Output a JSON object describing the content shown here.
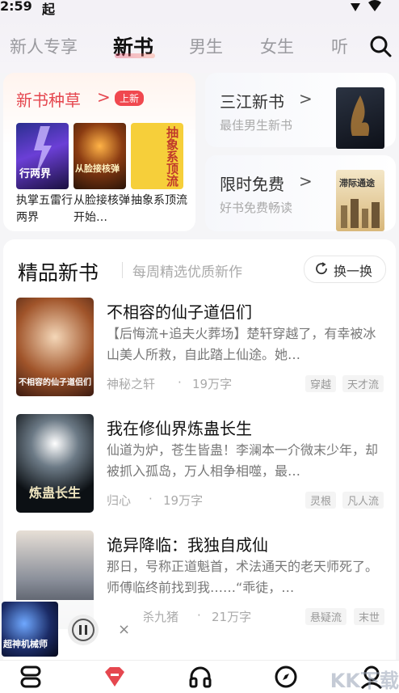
{
  "status_bar": {
    "time": "2:59",
    "app_glyph": "起"
  },
  "tabs": [
    {
      "label": "新人专享"
    },
    {
      "label": "新书"
    },
    {
      "label": "男生"
    },
    {
      "label": "女生"
    },
    {
      "label": "听"
    }
  ],
  "featured": {
    "title": "新书种草",
    "arrow": ">",
    "badge": "上新",
    "books": [
      {
        "caption": "执掌五雷行两界",
        "cover_text": "行两界"
      },
      {
        "caption": "从脸接核弹开始…",
        "cover_text": "从脸接核弹"
      },
      {
        "caption": "抽象系顶流",
        "cover_text": "抽象系顶流"
      }
    ]
  },
  "sanjiang": {
    "title": "三江新书",
    "arrow": ">",
    "subtitle": "最佳男生新书"
  },
  "free": {
    "title": "限时免费",
    "arrow": ">",
    "subtitle": "好书免费畅读",
    "cover_text": "滞际通途"
  },
  "section": {
    "title": "精品新书",
    "subtitle": "每周精选优质新作",
    "refresh_label": "换一换",
    "items": [
      {
        "title": "不相容的仙子道侣们",
        "desc": "【后悔流+追夫火葬场】楚轩穿越了，有幸被冰山美人所救，自此踏上仙途。她…",
        "author": "神秘之轩",
        "dot": "·",
        "words": "19万字",
        "tags": [
          "穿越",
          "天才流"
        ],
        "cover_text": "不相容的仙子道侣们"
      },
      {
        "title": "我在修仙界炼蛊长生",
        "desc": "仙道为炉，苍生皆蛊！李澜本一介微末少年，却被抓入孤岛，万人相争相噬，最…",
        "author": "归心",
        "dot": "·",
        "words": "19万字",
        "tags": [
          "灵根",
          "凡人流"
        ],
        "cover_text": "炼蛊长生"
      },
      {
        "title": "诡异降临：我独自成仙",
        "desc": "那日，号称正道魁首，术法通天的老天师死了。师傅临终前找到我……“乖徒，…",
        "author": "杀九猪",
        "dot": "·",
        "words": "21万字",
        "tags": [
          "悬疑流",
          "末世"
        ],
        "cover_text": ""
      }
    ]
  },
  "player": {
    "cover_text": "超神机械师",
    "close": "×"
  },
  "watermark": "KK下载",
  "colors": {
    "accent": "#e5474f",
    "badge": "#f0484f"
  }
}
